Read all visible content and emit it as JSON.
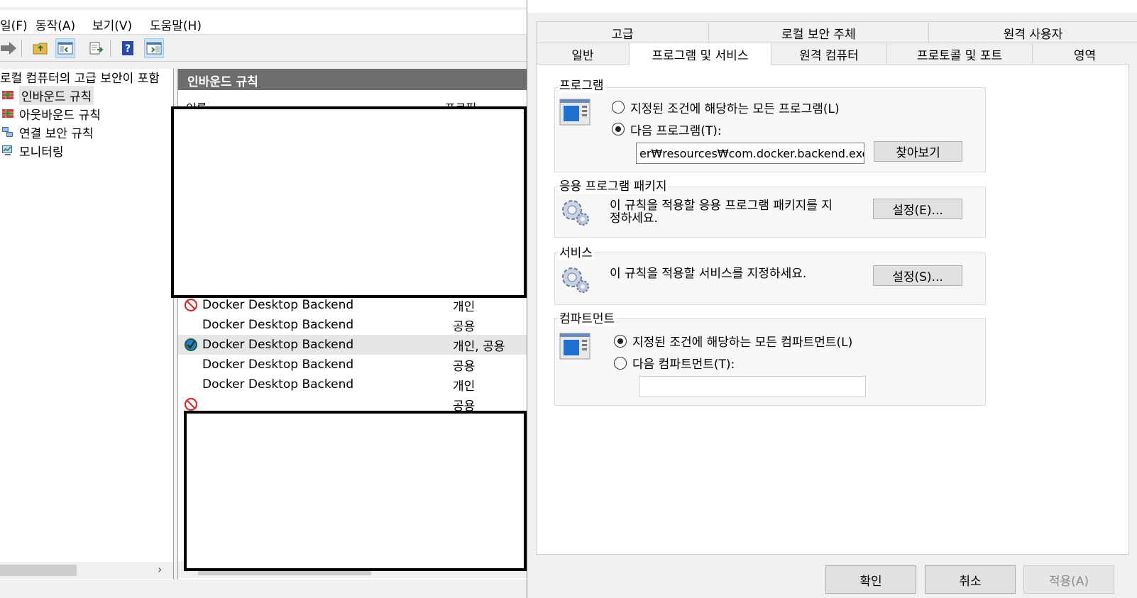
{
  "menu": [
    "일(F)",
    "동작(A)",
    "보기(V)",
    "도움말(H)"
  ],
  "tree": {
    "root": "로컬 컴퓨터의 고급 보안이 포함",
    "items": [
      "인바운드 규칙",
      "아웃바운드 규칙",
      "연결 보안 규칙",
      "모니터링"
    ]
  },
  "list": {
    "title": "인바운드 규칙",
    "col_name": "이름",
    "col_profile": "프로필",
    "rows": [
      {
        "name": "Docker Desktop Backend",
        "profile": "개인",
        "status": "blocked"
      },
      {
        "name": "Docker Desktop Backend",
        "profile": "공용",
        "status": "none"
      },
      {
        "name": "Docker Desktop Backend",
        "profile": "개인, 공용",
        "status": "allowed"
      },
      {
        "name": "Docker Desktop Backend",
        "profile": "공용",
        "status": "none"
      },
      {
        "name": "Docker Desktop Backend",
        "profile": "개인",
        "status": "none"
      }
    ],
    "partial_row_profile": "공용"
  },
  "dialog": {
    "tabs_row1": [
      "고급",
      "로컬 보안 주체",
      "원격 사용자"
    ],
    "tabs_row2": [
      "일반",
      "프로그램 및 서비스",
      "원격 컴퓨터",
      "프로토콜 및 포트",
      "영역"
    ],
    "active_tab": "프로그램 및 서비스",
    "program": {
      "title": "프로그램",
      "opt_all": "지정된 조건에 해당하는 모든 프로그램(L)",
      "opt_this": "다음 프로그램(T):",
      "path": "er₩resources₩com.docker.backend.exe",
      "browse": "찾아보기"
    },
    "package": {
      "title": "응용 프로그램 패키지",
      "text1": "이 규칙을 적용할 응용 프로그램 패키지를 지",
      "text2": "정하세요.",
      "button": "설정(E)..."
    },
    "services": {
      "title": "서비스",
      "text": "이 규칙을 적용할 서비스를 지정하세요.",
      "button": "설정(S)..."
    },
    "component": {
      "title": "컴파트먼트",
      "opt_all": "지정된 조건에 해당하는 모든 컴파트먼트(L)",
      "opt_this": "다음 컴파트먼트(T):"
    },
    "footer": {
      "ok": "확인",
      "cancel": "취소",
      "apply": "적용(A)"
    }
  }
}
